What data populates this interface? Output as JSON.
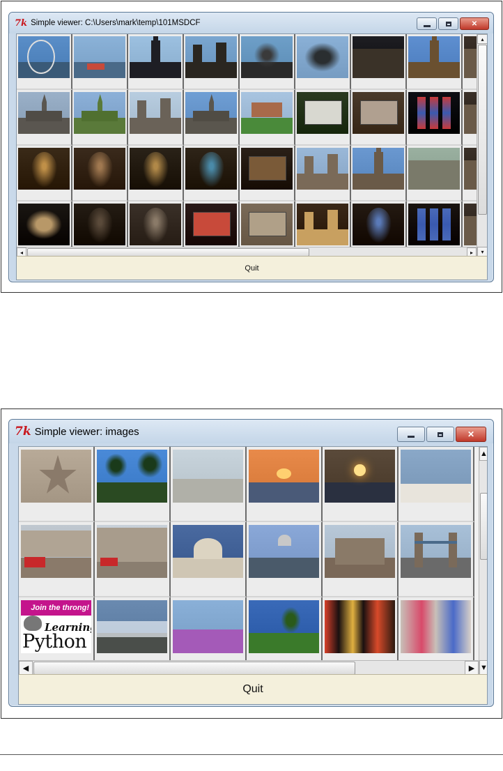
{
  "figure1": {
    "window": {
      "title": "Simple viewer: C:\\Users\\mark\\temp\\101MSDCF",
      "app_icon": "tk-icon",
      "minimize_icon": "minimize-icon",
      "maximize_icon": "maximize-icon",
      "close_icon": "close-icon"
    },
    "thumbnails": [
      "ferris-wheel-thames",
      "thames-river-boat",
      "big-ben-silhouette",
      "westminster-abbey",
      "tree-sculpture",
      "statue-chariot",
      "dark-building-night",
      "big-ben-clock",
      "partial-edge",
      "cathedral-spire-gray",
      "cathedral-spire-green-lawn",
      "gothic-cathedral-facade",
      "cathedral-spire-blue",
      "garden-house",
      "plaque-garden",
      "stone-tomb",
      "stained-glass-window",
      "partial-edge",
      "cathedral-nave-gold",
      "cathedral-aisle",
      "cathedral-altar",
      "church-interior-windows",
      "bronze-plaque",
      "gothic-towers",
      "cathedral-tower",
      "ruins-courtyard",
      "partial-edge",
      "stone-carving",
      "crypt-arches",
      "vaulted-cellar",
      "museum-display-red",
      "carved-stone-chest",
      "gothic-shrine",
      "nave-windows",
      "stained-glass-dark",
      "partial-edge"
    ],
    "quit_label": "Quit",
    "scroll_icons": {
      "left": "◂",
      "right": "▸",
      "up": "▴",
      "down": "▾"
    }
  },
  "figure2": {
    "window": {
      "title": "Simple viewer: images",
      "app_icon": "tk-icon",
      "minimize_icon": "minimize-icon",
      "maximize_icon": "maximize-icon",
      "close_icon": "close-icon"
    },
    "thumbnails": [
      "starfish-sand",
      "palm-trees",
      "beach-birds",
      "sunset-sea",
      "sunset-beach-glow",
      "white-beach",
      "street-plaza-buses",
      "town-square-fountain",
      "st-pauls-cathedral",
      "millennium-bridge",
      "tower-of-london",
      "tower-bridge",
      "learning-python-cover",
      "rocky-coast-waves",
      "purple-flower-coast",
      "park-trees",
      "times-square-night",
      "broadway-billboards"
    ],
    "logo_texts": {
      "banner": "Join the throng!",
      "learning": "Learning",
      "python": "Python"
    },
    "quit_label": "Quit",
    "scroll_icons": {
      "left": "◀",
      "right": "▶",
      "up": "▲",
      "down": "▼"
    }
  }
}
